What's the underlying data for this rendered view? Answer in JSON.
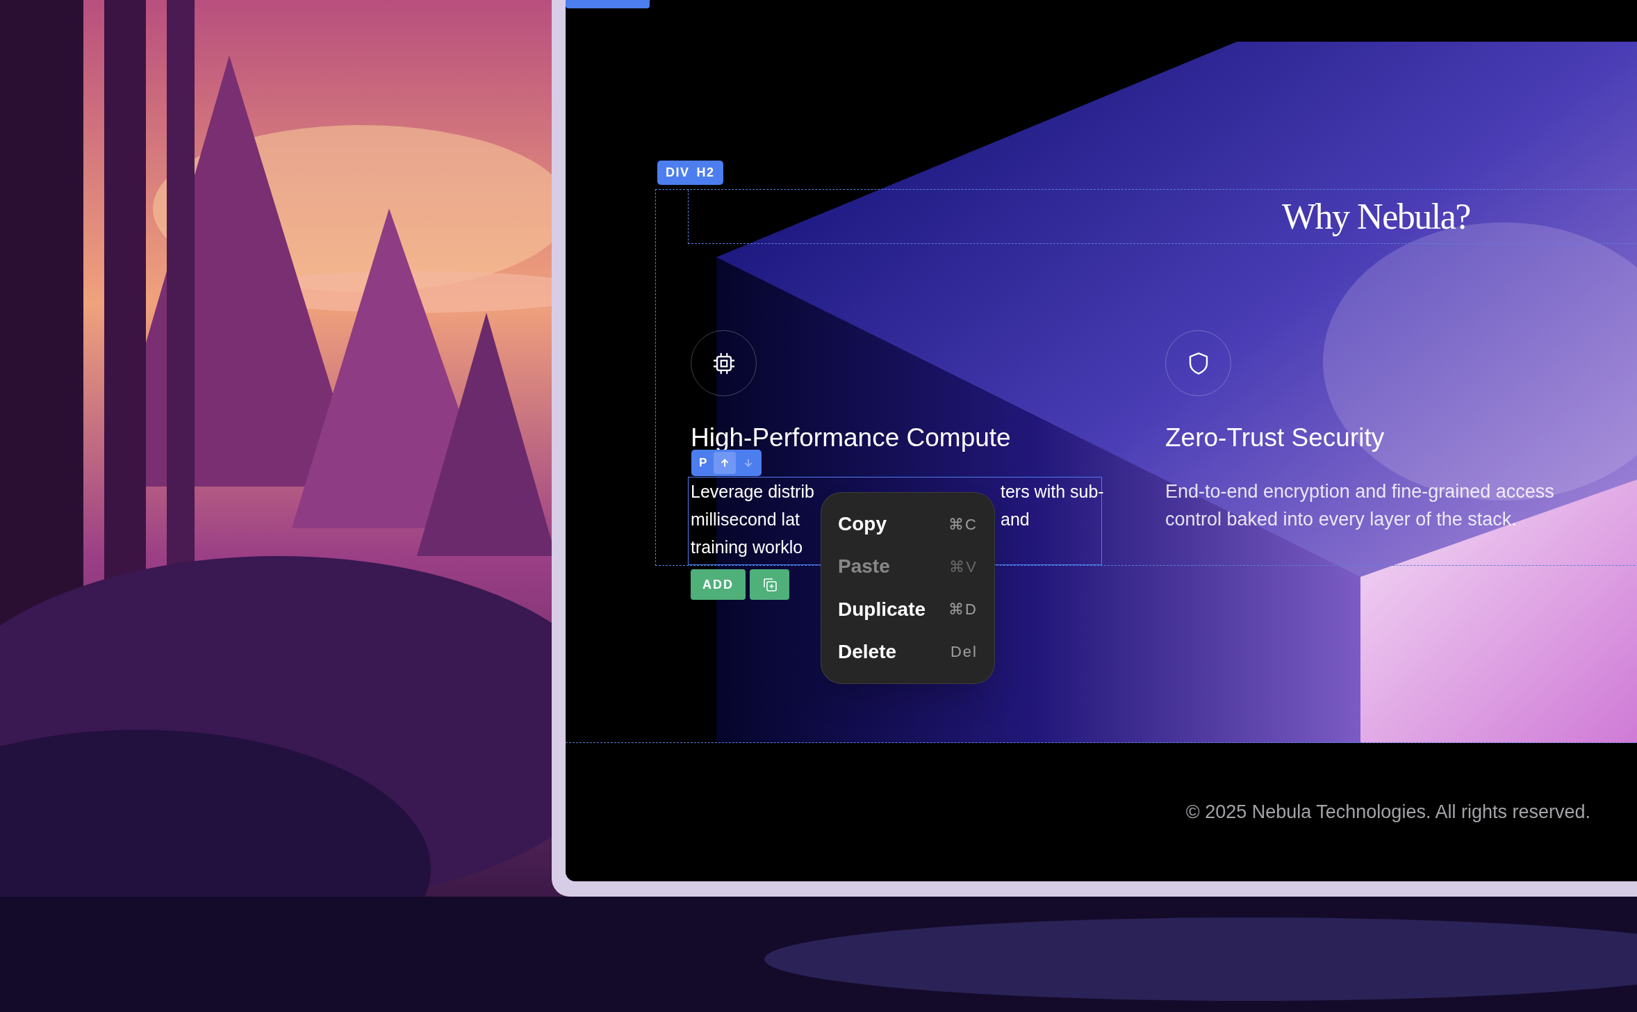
{
  "desktop": {
    "wallpaper": {
      "kind": "picture"
    }
  },
  "canvas": {
    "hero": {
      "kind": "picture"
    },
    "breadcrumb": [
      "DIV",
      "H2"
    ],
    "heading": "Why Nebula?",
    "features": [
      {
        "kind": "chip",
        "title": "High-Performance Compute",
        "selected": true,
        "text_lines": [
          [
            "Leverage distrib",
            "ters with sub-"
          ],
          [
            "millisecond lat",
            "and"
          ],
          [
            "training worklo"
          ]
        ]
      },
      {
        "kind": "shield",
        "title": "Zero-Trust Security",
        "selected": false,
        "text": "End-to-end encryption and fine-grained access control baked into every layer of the stack."
      }
    ],
    "element_toolbar": {
      "tag": "P",
      "buttons": [
        {
          "kind": "move-up",
          "disabled": false
        },
        {
          "kind": "move-down",
          "disabled": true
        }
      ]
    },
    "actions": [
      {
        "kind": "add",
        "label": "ADD"
      },
      {
        "kind": "duplicate"
      }
    ],
    "context_menu": [
      {
        "label": "Copy",
        "shortcut": "⌘C",
        "disabled": false
      },
      {
        "label": "Paste",
        "shortcut": "⌘V",
        "disabled": true
      },
      {
        "label": "Duplicate",
        "shortcut": "⌘D",
        "disabled": false
      },
      {
        "label": "Delete",
        "shortcut": "Del",
        "disabled": false
      }
    ],
    "footer": "© 2025 Nebula Technologies. All rights reserved."
  }
}
